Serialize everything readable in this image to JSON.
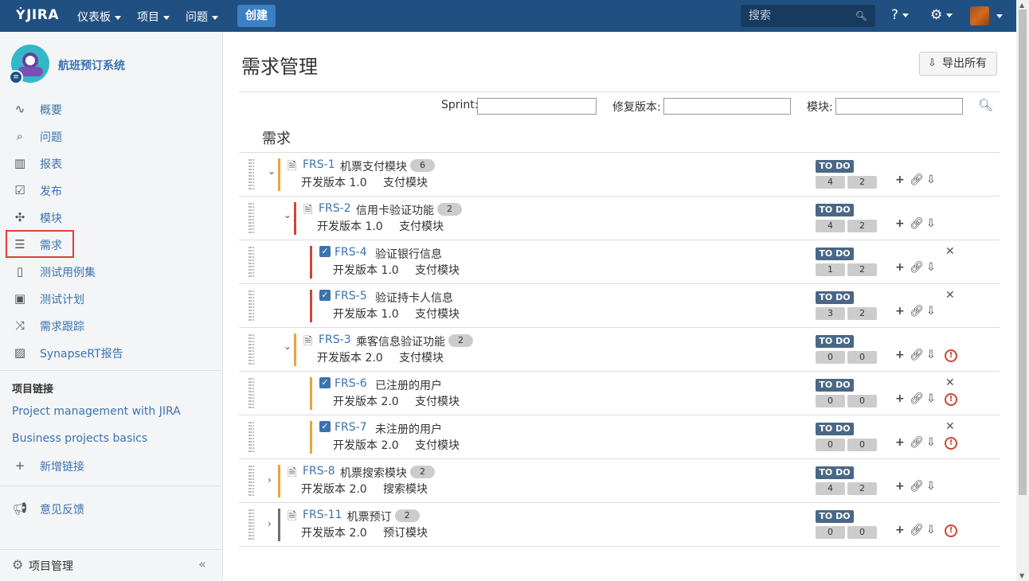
{
  "topbar": {
    "logo": "JIRA",
    "nav": [
      {
        "label": "仪表板"
      },
      {
        "label": "项目"
      },
      {
        "label": "问题"
      }
    ],
    "create_label": "创建",
    "search_placeholder": "搜索"
  },
  "sidebar": {
    "project_name": "航班预订系统",
    "items": [
      {
        "label": "概要",
        "icon": "activity-icon"
      },
      {
        "label": "问题",
        "icon": "search-issues-icon"
      },
      {
        "label": "报表",
        "icon": "bar-chart-icon"
      },
      {
        "label": "发布",
        "icon": "release-icon"
      },
      {
        "label": "模块",
        "icon": "puzzle-icon"
      },
      {
        "label": "需求",
        "icon": "requirements-icon",
        "selected": true
      },
      {
        "label": "测试用例集",
        "icon": "testcase-icon"
      },
      {
        "label": "测试计划",
        "icon": "testplan-icon"
      },
      {
        "label": "需求跟踪",
        "icon": "shuffle-icon"
      },
      {
        "label": "SynapseRT报告",
        "icon": "report-icon"
      }
    ],
    "links_title": "项目链接",
    "links": [
      "Project management with JIRA",
      "Business projects basics"
    ],
    "add_link": "新增链接",
    "feedback": "意见反馈",
    "footer_label": "项目管理",
    "collapse": "«"
  },
  "main": {
    "title": "需求管理",
    "export_label": "导出所有",
    "filters": {
      "sprint": "Sprint:",
      "fix_version": "修复版本:",
      "module": "模块:"
    },
    "section_title": "需求",
    "status_color": "#4a6785",
    "requirements": [
      {
        "key": "FRS-1",
        "summary": "机票支付模块",
        "count": "6",
        "version": "开发版本 1.0",
        "component": "支付模块",
        "status": "TO DO",
        "n1": "4",
        "n2": "2",
        "level": 0,
        "type": "doc",
        "toggle": "⌄",
        "bar": "#f0a03c",
        "close": false,
        "warn": false
      },
      {
        "key": "FRS-2",
        "summary": "信用卡验证功能",
        "count": "2",
        "version": "开发版本 1.0",
        "component": "支付模块",
        "status": "TO DO",
        "n1": "4",
        "n2": "2",
        "level": 1,
        "type": "doc",
        "toggle": "⌄",
        "bar": "#d04437",
        "close": false,
        "warn": false
      },
      {
        "key": "FRS-4",
        "summary": "验证银行信息",
        "count": "",
        "version": "开发版本 1.0",
        "component": "支付模块",
        "status": "TO DO",
        "n1": "1",
        "n2": "2",
        "level": 2,
        "type": "check",
        "toggle": "",
        "bar": "#d04437",
        "close": true,
        "warn": false
      },
      {
        "key": "FRS-5",
        "summary": "验证持卡人信息",
        "count": "",
        "version": "开发版本 1.0",
        "component": "支付模块",
        "status": "TO DO",
        "n1": "3",
        "n2": "2",
        "level": 2,
        "type": "check",
        "toggle": "",
        "bar": "#d04437",
        "close": true,
        "warn": false
      },
      {
        "key": "FRS-3",
        "summary": "乘客信息验证功能",
        "count": "2",
        "version": "开发版本 2.0",
        "component": "支付模块",
        "status": "TO DO",
        "n1": "0",
        "n2": "0",
        "level": 1,
        "type": "doc",
        "toggle": "⌄",
        "bar": "#f0a03c",
        "close": false,
        "warn": true
      },
      {
        "key": "FRS-6",
        "summary": "已注册的用户",
        "count": "",
        "version": "开发版本 2.0",
        "component": "支付模块",
        "status": "TO DO",
        "n1": "0",
        "n2": "0",
        "level": 2,
        "type": "check",
        "toggle": "",
        "bar": "#f0a03c",
        "close": true,
        "warn": true
      },
      {
        "key": "FRS-7",
        "summary": "未注册的用户",
        "count": "",
        "version": "开发版本 2.0",
        "component": "支付模块",
        "status": "TO DO",
        "n1": "0",
        "n2": "0",
        "level": 2,
        "type": "check",
        "toggle": "",
        "bar": "#f0a03c",
        "close": true,
        "warn": true
      },
      {
        "key": "FRS-8",
        "summary": "机票搜索模块",
        "count": "2",
        "version": "开发版本 2.0",
        "component": "搜索模块",
        "status": "TO DO",
        "n1": "4",
        "n2": "2",
        "level": 0,
        "type": "doc",
        "toggle": "›",
        "bar": "#f0a03c",
        "close": false,
        "warn": false
      },
      {
        "key": "FRS-11",
        "summary": "机票预订",
        "count": "2",
        "version": "开发版本 2.0",
        "component": "预订模块",
        "status": "TO DO",
        "n1": "0",
        "n2": "0",
        "level": 0,
        "type": "doc",
        "toggle": "›",
        "bar": "#707070",
        "close": false,
        "warn": true
      }
    ]
  }
}
